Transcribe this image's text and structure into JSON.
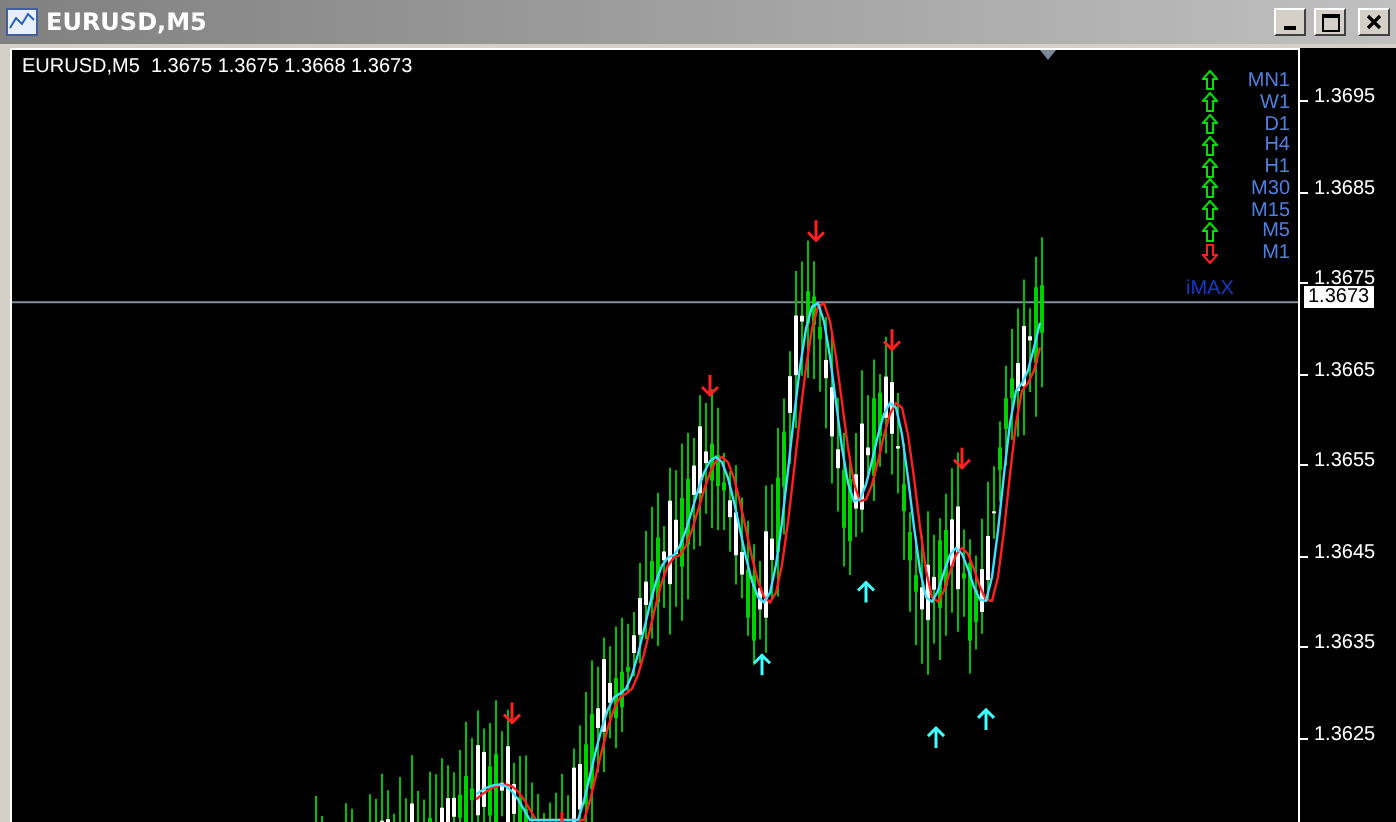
{
  "window": {
    "title": "EURUSD,M5"
  },
  "chart": {
    "header": "EURUSD,M5  1.3675 1.3675 1.3668 1.3673",
    "timeframes": [
      {
        "label": "MN1",
        "kind": "up"
      },
      {
        "label": "W1",
        "kind": "up"
      },
      {
        "label": "D1",
        "kind": "up"
      },
      {
        "label": "H4",
        "kind": "up"
      },
      {
        "label": "H1",
        "kind": "up"
      },
      {
        "label": "M30",
        "kind": "up"
      },
      {
        "label": "M15",
        "kind": "up"
      },
      {
        "label": "M5",
        "kind": "up"
      },
      {
        "label": "M1",
        "kind": "down"
      }
    ],
    "indicator_label": "iMAX"
  },
  "price_axis": {
    "labels": [
      "1.3695",
      "1.3685",
      "1.3675",
      "1.3665",
      "1.3655",
      "1.3645",
      "1.3635",
      "1.3625"
    ],
    "current_price": "1.3673"
  }
}
